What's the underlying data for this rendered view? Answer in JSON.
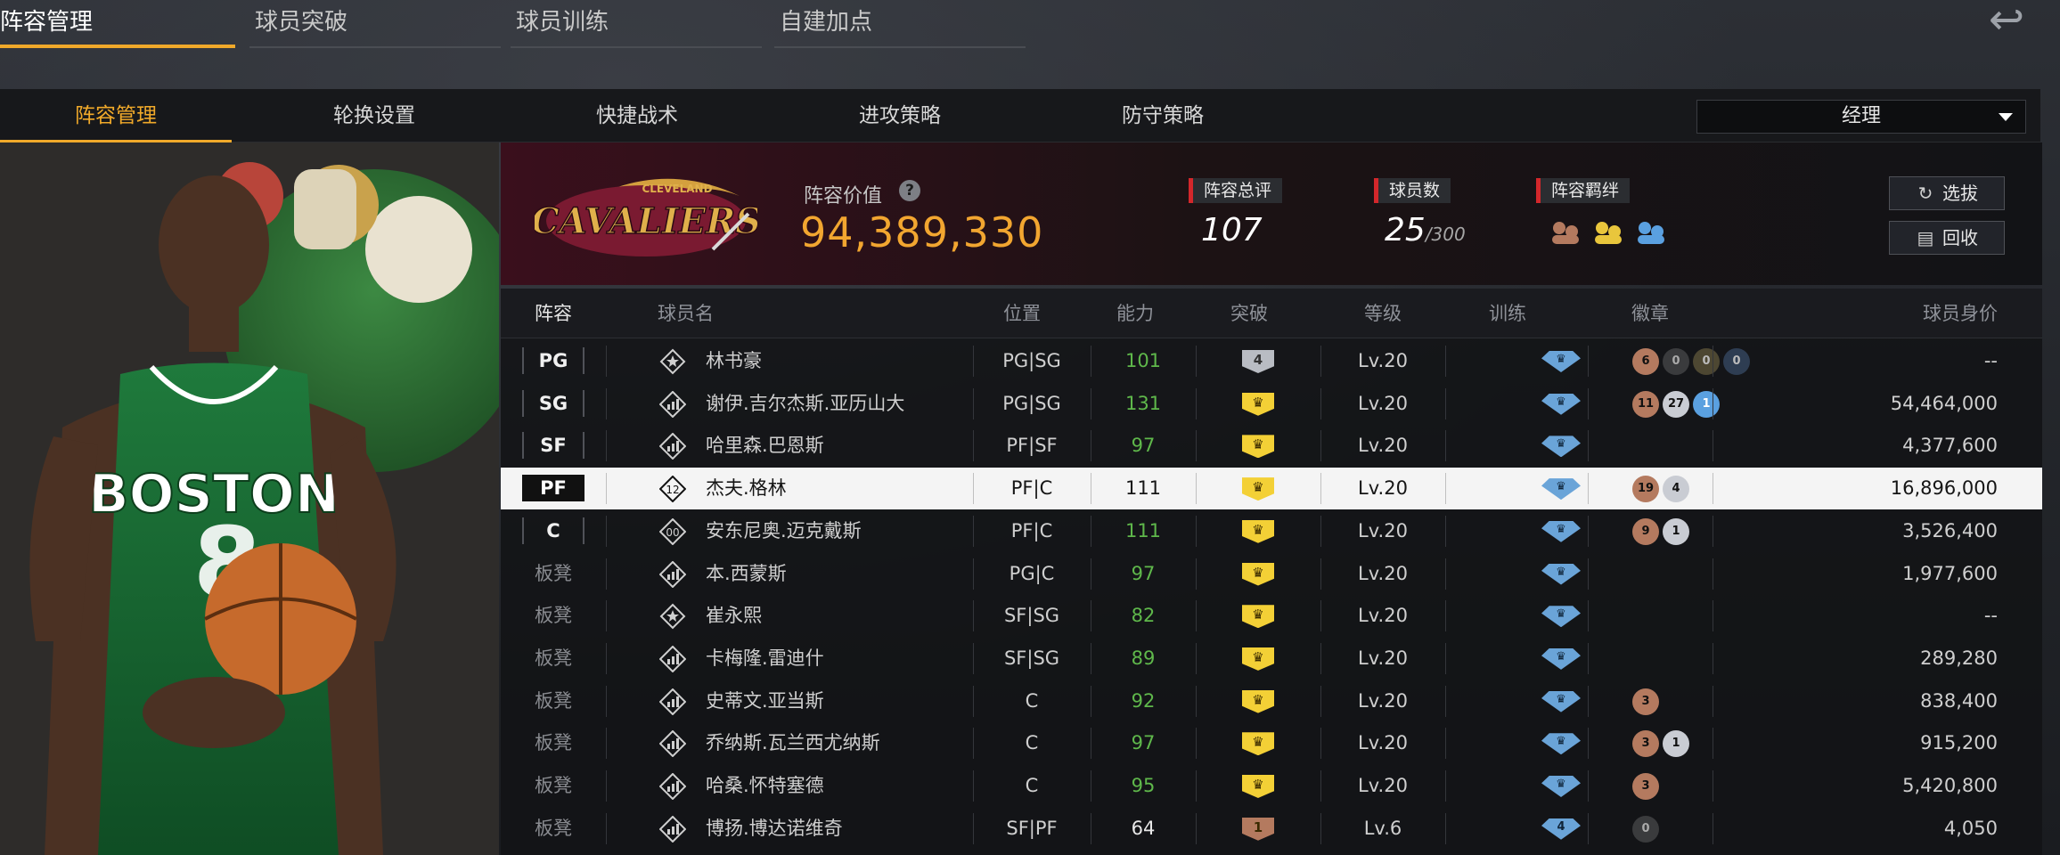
{
  "top_tabs": [
    "阵容管理",
    "球员突破",
    "球员训练",
    "自建加点"
  ],
  "sub_tabs": [
    "阵容管理",
    "轮换设置",
    "快捷战术",
    "进攻策略",
    "防守策略"
  ],
  "role_select": "经理",
  "team": {
    "logo_text": "CAVALIERS",
    "logo_city": "CLEVELAND",
    "lineup_value_label": "阵容价值",
    "lineup_value": "94,389,330"
  },
  "stats": {
    "rating_label": "阵容总评",
    "rating": "107",
    "players_label": "球员数",
    "players": "25",
    "players_max": "/300",
    "bonds_label": "阵容羁绊"
  },
  "buttons": {
    "select": "选拔",
    "recycle": "回收"
  },
  "columns": [
    "阵容",
    "球员名",
    "位置",
    "能力",
    "突破",
    "等级",
    "训练",
    "徽章",
    "球员身价"
  ],
  "players": [
    {
      "slot": "PG",
      "bench": false,
      "icon": "star",
      "name": "林书豪",
      "position": "PG|SG",
      "ability": "101",
      "green": true,
      "breakthrough": "4",
      "btype": "silver",
      "level": "Lv.20",
      "train": "",
      "badges": [
        {
          "v": "6",
          "c": "b-bronze"
        },
        {
          "v": "0",
          "c": "b-dark"
        },
        {
          "v": "0",
          "c": "b-darkgold"
        },
        {
          "v": "0",
          "c": "b-darkblue"
        }
      ],
      "value": "--"
    },
    {
      "slot": "SG",
      "bench": false,
      "icon": "bars",
      "name": "谢伊.吉尔杰斯.亚历山大",
      "position": "PG|SG",
      "ability": "131",
      "green": true,
      "breakthrough": "",
      "btype": "gold",
      "level": "Lv.20",
      "train": "",
      "badges": [
        {
          "v": "11",
          "c": "b-bronze"
        },
        {
          "v": "27",
          "c": "b-silver"
        },
        {
          "v": "1",
          "c": "b-blue"
        }
      ],
      "value": "54,464,000"
    },
    {
      "slot": "SF",
      "bench": false,
      "icon": "bars",
      "name": "哈里森.巴恩斯",
      "position": "PF|SF",
      "ability": "97",
      "green": true,
      "breakthrough": "",
      "btype": "gold",
      "level": "Lv.20",
      "train": "",
      "badges": [],
      "value": "4,377,600"
    },
    {
      "slot": "PF",
      "bench": false,
      "icon": "twelve",
      "name": "杰夫.格林",
      "position": "PF|C",
      "ability": "111",
      "green": false,
      "breakthrough": "",
      "btype": "gold",
      "level": "Lv.20",
      "train": "",
      "badges": [
        {
          "v": "19",
          "c": "b-bronze"
        },
        {
          "v": "4",
          "c": "b-silver"
        }
      ],
      "value": "16,896,000",
      "selected": true
    },
    {
      "slot": "C",
      "bench": false,
      "icon": "double",
      "name": "安东尼奥.迈克戴斯",
      "position": "PF|C",
      "ability": "111",
      "green": true,
      "breakthrough": "",
      "btype": "gold",
      "level": "Lv.20",
      "train": "",
      "badges": [
        {
          "v": "9",
          "c": "b-bronze"
        },
        {
          "v": "1",
          "c": "b-silver"
        }
      ],
      "value": "3,526,400"
    },
    {
      "slot": "板凳",
      "bench": true,
      "icon": "bars",
      "name": "本.西蒙斯",
      "position": "PG|C",
      "ability": "97",
      "green": true,
      "breakthrough": "",
      "btype": "gold",
      "level": "Lv.20",
      "train": "",
      "badges": [],
      "value": "1,977,600"
    },
    {
      "slot": "板凳",
      "bench": true,
      "icon": "star",
      "name": "崔永熙",
      "position": "SF|SG",
      "ability": "82",
      "green": true,
      "breakthrough": "",
      "btype": "gold",
      "level": "Lv.20",
      "train": "",
      "badges": [],
      "value": "--"
    },
    {
      "slot": "板凳",
      "bench": true,
      "icon": "bars",
      "name": "卡梅隆.雷迪什",
      "position": "SF|SG",
      "ability": "89",
      "green": true,
      "breakthrough": "",
      "btype": "gold",
      "level": "Lv.20",
      "train": "",
      "badges": [],
      "value": "289,280"
    },
    {
      "slot": "板凳",
      "bench": true,
      "icon": "bars",
      "name": "史蒂文.亚当斯",
      "position": "C",
      "ability": "92",
      "green": true,
      "breakthrough": "",
      "btype": "gold",
      "level": "Lv.20",
      "train": "",
      "badges": [
        {
          "v": "3",
          "c": "b-bronze"
        }
      ],
      "value": "838,400"
    },
    {
      "slot": "板凳",
      "bench": true,
      "icon": "bars",
      "name": "乔纳斯.瓦兰西尤纳斯",
      "position": "C",
      "ability": "97",
      "green": true,
      "breakthrough": "",
      "btype": "gold",
      "level": "Lv.20",
      "train": "",
      "badges": [
        {
          "v": "3",
          "c": "b-bronze"
        },
        {
          "v": "1",
          "c": "b-silver"
        }
      ],
      "value": "915,200"
    },
    {
      "slot": "板凳",
      "bench": true,
      "icon": "bars",
      "name": "哈桑.怀特塞德",
      "position": "C",
      "ability": "95",
      "green": true,
      "breakthrough": "",
      "btype": "gold",
      "level": "Lv.20",
      "train": "",
      "badges": [
        {
          "v": "3",
          "c": "b-bronze"
        }
      ],
      "value": "5,420,800"
    },
    {
      "slot": "板凳",
      "bench": true,
      "icon": "bars",
      "name": "博扬.博达诺维奇",
      "position": "SF|PF",
      "ability": "64",
      "green": false,
      "breakthrough": "1",
      "btype": "bronze",
      "level": "Lv.6",
      "train": "4",
      "badges": [
        {
          "v": "0",
          "c": "b-dark"
        }
      ],
      "value": "4,050"
    }
  ],
  "colors": {
    "accent": "#f0a92a",
    "red": "#d3272b",
    "green": "#5fb84b",
    "train": "#6aa4d8"
  }
}
